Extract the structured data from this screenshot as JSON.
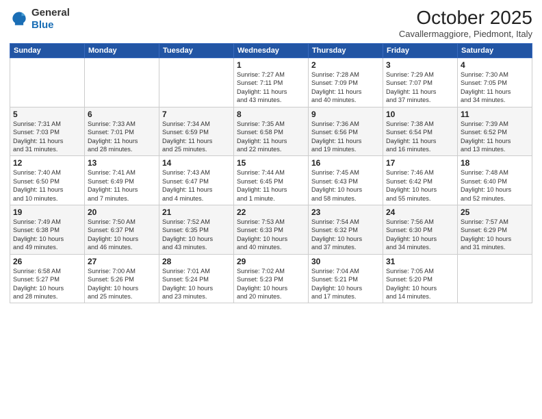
{
  "logo": {
    "general": "General",
    "blue": "Blue"
  },
  "header": {
    "title": "October 2025",
    "subtitle": "Cavallermaggiore, Piedmont, Italy"
  },
  "days_of_week": [
    "Sunday",
    "Monday",
    "Tuesday",
    "Wednesday",
    "Thursday",
    "Friday",
    "Saturday"
  ],
  "weeks": [
    [
      {
        "day": "",
        "info": ""
      },
      {
        "day": "",
        "info": ""
      },
      {
        "day": "",
        "info": ""
      },
      {
        "day": "1",
        "info": "Sunrise: 7:27 AM\nSunset: 7:11 PM\nDaylight: 11 hours\nand 43 minutes."
      },
      {
        "day": "2",
        "info": "Sunrise: 7:28 AM\nSunset: 7:09 PM\nDaylight: 11 hours\nand 40 minutes."
      },
      {
        "day": "3",
        "info": "Sunrise: 7:29 AM\nSunset: 7:07 PM\nDaylight: 11 hours\nand 37 minutes."
      },
      {
        "day": "4",
        "info": "Sunrise: 7:30 AM\nSunset: 7:05 PM\nDaylight: 11 hours\nand 34 minutes."
      }
    ],
    [
      {
        "day": "5",
        "info": "Sunrise: 7:31 AM\nSunset: 7:03 PM\nDaylight: 11 hours\nand 31 minutes."
      },
      {
        "day": "6",
        "info": "Sunrise: 7:33 AM\nSunset: 7:01 PM\nDaylight: 11 hours\nand 28 minutes."
      },
      {
        "day": "7",
        "info": "Sunrise: 7:34 AM\nSunset: 6:59 PM\nDaylight: 11 hours\nand 25 minutes."
      },
      {
        "day": "8",
        "info": "Sunrise: 7:35 AM\nSunset: 6:58 PM\nDaylight: 11 hours\nand 22 minutes."
      },
      {
        "day": "9",
        "info": "Sunrise: 7:36 AM\nSunset: 6:56 PM\nDaylight: 11 hours\nand 19 minutes."
      },
      {
        "day": "10",
        "info": "Sunrise: 7:38 AM\nSunset: 6:54 PM\nDaylight: 11 hours\nand 16 minutes."
      },
      {
        "day": "11",
        "info": "Sunrise: 7:39 AM\nSunset: 6:52 PM\nDaylight: 11 hours\nand 13 minutes."
      }
    ],
    [
      {
        "day": "12",
        "info": "Sunrise: 7:40 AM\nSunset: 6:50 PM\nDaylight: 11 hours\nand 10 minutes."
      },
      {
        "day": "13",
        "info": "Sunrise: 7:41 AM\nSunset: 6:49 PM\nDaylight: 11 hours\nand 7 minutes."
      },
      {
        "day": "14",
        "info": "Sunrise: 7:43 AM\nSunset: 6:47 PM\nDaylight: 11 hours\nand 4 minutes."
      },
      {
        "day": "15",
        "info": "Sunrise: 7:44 AM\nSunset: 6:45 PM\nDaylight: 11 hours\nand 1 minute."
      },
      {
        "day": "16",
        "info": "Sunrise: 7:45 AM\nSunset: 6:43 PM\nDaylight: 10 hours\nand 58 minutes."
      },
      {
        "day": "17",
        "info": "Sunrise: 7:46 AM\nSunset: 6:42 PM\nDaylight: 10 hours\nand 55 minutes."
      },
      {
        "day": "18",
        "info": "Sunrise: 7:48 AM\nSunset: 6:40 PM\nDaylight: 10 hours\nand 52 minutes."
      }
    ],
    [
      {
        "day": "19",
        "info": "Sunrise: 7:49 AM\nSunset: 6:38 PM\nDaylight: 10 hours\nand 49 minutes."
      },
      {
        "day": "20",
        "info": "Sunrise: 7:50 AM\nSunset: 6:37 PM\nDaylight: 10 hours\nand 46 minutes."
      },
      {
        "day": "21",
        "info": "Sunrise: 7:52 AM\nSunset: 6:35 PM\nDaylight: 10 hours\nand 43 minutes."
      },
      {
        "day": "22",
        "info": "Sunrise: 7:53 AM\nSunset: 6:33 PM\nDaylight: 10 hours\nand 40 minutes."
      },
      {
        "day": "23",
        "info": "Sunrise: 7:54 AM\nSunset: 6:32 PM\nDaylight: 10 hours\nand 37 minutes."
      },
      {
        "day": "24",
        "info": "Sunrise: 7:56 AM\nSunset: 6:30 PM\nDaylight: 10 hours\nand 34 minutes."
      },
      {
        "day": "25",
        "info": "Sunrise: 7:57 AM\nSunset: 6:29 PM\nDaylight: 10 hours\nand 31 minutes."
      }
    ],
    [
      {
        "day": "26",
        "info": "Sunrise: 6:58 AM\nSunset: 5:27 PM\nDaylight: 10 hours\nand 28 minutes."
      },
      {
        "day": "27",
        "info": "Sunrise: 7:00 AM\nSunset: 5:26 PM\nDaylight: 10 hours\nand 25 minutes."
      },
      {
        "day": "28",
        "info": "Sunrise: 7:01 AM\nSunset: 5:24 PM\nDaylight: 10 hours\nand 23 minutes."
      },
      {
        "day": "29",
        "info": "Sunrise: 7:02 AM\nSunset: 5:23 PM\nDaylight: 10 hours\nand 20 minutes."
      },
      {
        "day": "30",
        "info": "Sunrise: 7:04 AM\nSunset: 5:21 PM\nDaylight: 10 hours\nand 17 minutes."
      },
      {
        "day": "31",
        "info": "Sunrise: 7:05 AM\nSunset: 5:20 PM\nDaylight: 10 hours\nand 14 minutes."
      },
      {
        "day": "",
        "info": ""
      }
    ]
  ]
}
